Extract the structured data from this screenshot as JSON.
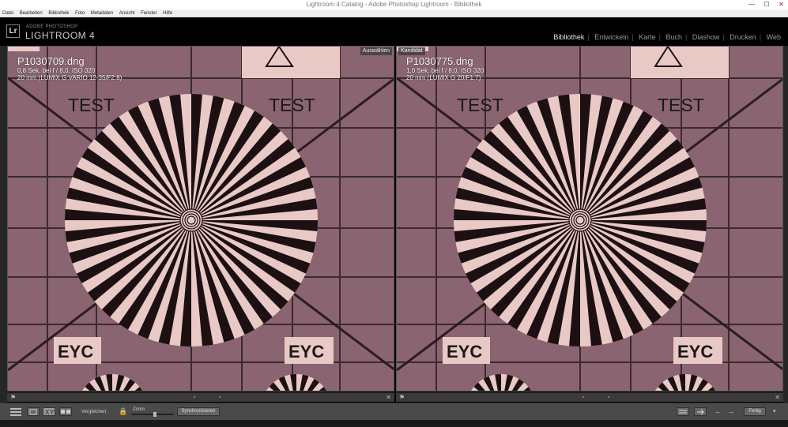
{
  "window": {
    "title": "Lightroom 4 Catalog - Adobe Photoshop Lightroom - Bibliothek",
    "min": "—",
    "max": "☐",
    "close": "✕"
  },
  "menu": [
    "Datei",
    "Bearbeiten",
    "Bibliothek",
    "Foto",
    "Metadaten",
    "Ansicht",
    "Fenster",
    "Hilfe"
  ],
  "header": {
    "logo": "Lr",
    "brand_small": "ADOBE PHOTOSHOP",
    "brand": "LIGHTROOM 4",
    "modules": [
      "Bibliothek",
      "Entwickeln",
      "Karte",
      "Buch",
      "Diashow",
      "Drucken",
      "Web"
    ],
    "active_module": "Bibliothek"
  },
  "left_panel": {
    "tag": "Auswählen",
    "filename": "P1030709.dng",
    "exposure": "0,8 Sek. bei f / 8,0, ISO 320",
    "lens": "20 mm (LUMIX G VARIO 12-35/F2.8)"
  },
  "right_panel": {
    "tag": "Kandidat",
    "filename": "P1030775.dng",
    "exposure": "1,0 Sek. bei f / 8,0, ISO 320",
    "lens": "20 mm (LUMIX G 20/F1.7)"
  },
  "chart_text": {
    "test": "TEST",
    "eyc": "EYC"
  },
  "toolbar": {
    "compare_label": "Vergleichen:",
    "zoom_label": "Zoom",
    "sync_button": "Synchronisieren",
    "done_button": "Fertig"
  },
  "colors": {
    "chart_bg": "#8a6470",
    "chart_light": "#e9c9c6",
    "chart_dark": "#1c1012"
  }
}
